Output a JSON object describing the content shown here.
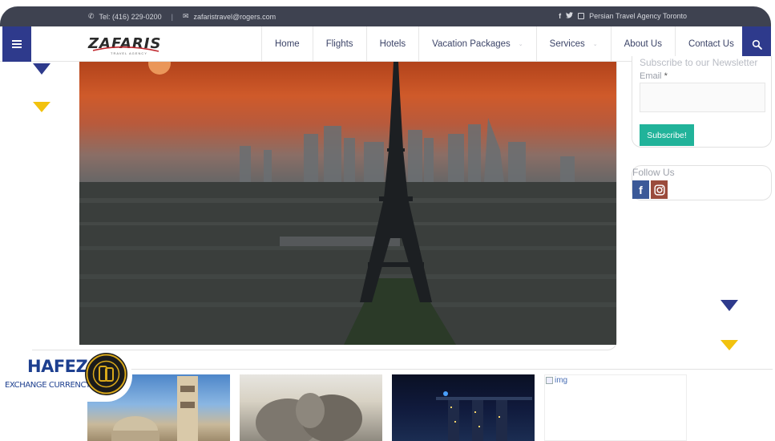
{
  "topbar": {
    "phone": "Tel: (416) 229-0200",
    "separator": "|",
    "email": "zafaristravel@rogers.com",
    "tagline": "Persian Travel Agency Toronto"
  },
  "logo": {
    "text": "ZAFARIS",
    "subtitle": "TRAVEL AGENCY"
  },
  "nav": {
    "items": [
      {
        "label": "Home",
        "has_dropdown": false
      },
      {
        "label": "Flights",
        "has_dropdown": false
      },
      {
        "label": "Hotels",
        "has_dropdown": false
      },
      {
        "label": "Vacation Packages",
        "has_dropdown": true
      },
      {
        "label": "Services",
        "has_dropdown": true
      },
      {
        "label": "About Us",
        "has_dropdown": false
      },
      {
        "label": "Contact Us",
        "has_dropdown": false
      }
    ],
    "caret": "⌄"
  },
  "sidebar": {
    "newsletter_title": "Subscribe to our Newsletter",
    "email_label": "Email",
    "required_mark": "*",
    "subscribe_label": "Subscribe!",
    "follow_title": "Follow Us"
  },
  "gallery": {
    "broken_image_alt": "img"
  },
  "badge": {
    "name": "HAFEZ",
    "subtitle": "EXCHANGE CURRENCY"
  },
  "colors": {
    "topbar": "#3e4250",
    "nav_accent": "#2e3a8c",
    "subscribe": "#21b39a",
    "triangle_yellow": "#f2c20e",
    "facebook": "#3b5998",
    "instagram": "#9b4b3c"
  },
  "icons": {
    "phone": "phone-icon",
    "email": "envelope-icon",
    "facebook": "facebook-icon",
    "twitter": "twitter-icon",
    "instagram": "instagram-icon",
    "menu": "hamburger-menu-icon",
    "search": "search-icon"
  }
}
